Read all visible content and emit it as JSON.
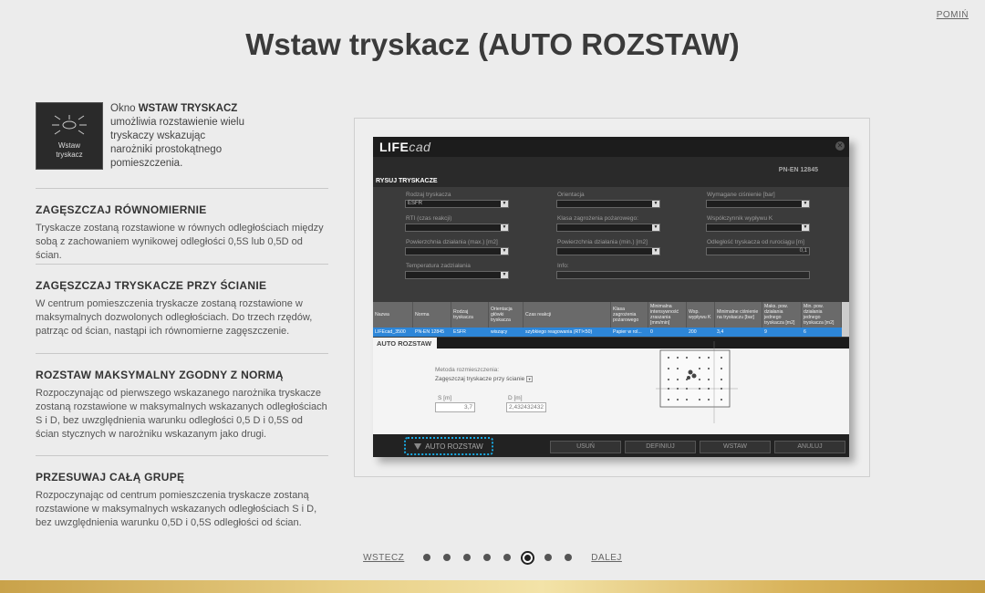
{
  "header": {
    "skip_label": "POMIŃ",
    "title": "Wstaw tryskacz (AUTO ROZSTAW)"
  },
  "intro": {
    "icon_label": "Wstaw\ntryskacz",
    "text_before": "Okno ",
    "text_bold": "WSTAW TRYSKACZ",
    "text_after": " umożliwia rozstawienie wielu tryskaczy wskazując narożniki prostokątnego pomieszczenia."
  },
  "sections": [
    {
      "heading": "ZAGĘSZCZAJ RÓWNOMIERNIE",
      "text": "Tryskacze zostaną rozstawione w równych odległościach między sobą z zachowaniem wynikowej odległości 0,5S lub 0,5D od ścian."
    },
    {
      "heading": "ZAGĘSZCZAJ TRYSKACZE PRZY ŚCIANIE",
      "text": "W centrum pomieszczenia tryskacze zostaną rozstawione w maksymalnych dozwolonych odległościach. Do trzech rzędów, patrząc od ścian, nastąpi ich równomierne zagęszczenie."
    },
    {
      "heading": "ROZSTAW MAKSYMALNY ZGODNY Z NORMĄ",
      "text": "Rozpoczynając od pierwszego wskazanego narożnika tryskacze zostaną rozstawione w maksymalnych wskazanych odległościach S i D, bez uwzględnienia warunku odległości 0,5 D i 0,5S od ścian stycznych w narożniku wskazanym jako drugi."
    },
    {
      "heading": "PRZESUWAJ CAŁĄ GRUPĘ",
      "text": "Rozpoczynając od centrum pomieszczenia tryskacze zostaną rozstawione w maksymalnych wskazanych odległościach S i D, bez uwzględnienia warunku 0,5D i 0,5S odległości od ścian."
    }
  ],
  "app": {
    "logo_main": "LIFE",
    "logo_cad": "cad",
    "close_icon": "close-icon",
    "norm": "PN-EN 12845",
    "section_title": "RYSUJ TRYSKACZE",
    "fields": {
      "rodzaj_label": "Rodzaj tryskacza",
      "rodzaj_value": "ESFR",
      "orientacja_label": "Orientacja",
      "cisnienie_label": "Wymagane ciśnienie [bar]",
      "rti_label": "RTI (czas reakcji)",
      "klasa_label": "Klasa zagrożenia pożarowego:",
      "wspolczynnik_label": "Współczynnik wypływu K",
      "pow_max_label": "Powierzchnia działania (max.) [m2]",
      "pow_min_label": "Powierzchnia działania (min.) [m2]",
      "odleglosc_label": "Odległość tryskacza od rurociągu [m]",
      "odleglosc_value": "0,1",
      "temperatura_label": "Temperatura zadziałania",
      "info_label": "Info:"
    },
    "table": {
      "headers": [
        "Nazwa",
        "Norma",
        "Rodzaj tryskacza",
        "Orientacja główki tryskacza",
        "Czas reakcji",
        "Klasa zagrożenia pożarowego",
        "Minimalna intensywność zraszania [mm/min]",
        "Wsp. wypływu K",
        "Minimalne ciśnienie na tryskaczu [bar]",
        "Maks. pow. działania jednego tryskacza [m2]",
        "Min. pow. działania jednego tryskacza [m2]"
      ],
      "row": [
        "LIFEcad_3500",
        "PN-EN 12845",
        "ESFR",
        "wiszący",
        "szybkiego reagowania (RTI<50)",
        "Papier w rol...",
        "0",
        "200",
        "3,4",
        "9",
        "6"
      ]
    },
    "auto": {
      "tab_label": "AUTO ROZSTAW",
      "method_label": "Metoda rozmieszczenia:",
      "method_value": "Zagęszczaj tryskacze przy ścianie",
      "s_label": "S [m]",
      "s_value": "3,7",
      "d_label": "D [m]",
      "d_value": "2,432432432"
    },
    "footer": {
      "auto_button": "AUTO ROZSTAW",
      "usun": "USUŃ",
      "definiuj": "DEFINIUJ",
      "wstaw": "WSTAW",
      "anuluj": "ANULUJ"
    }
  },
  "pager": {
    "prev": "WSTECZ",
    "next": "DALEJ",
    "pages": 8,
    "active_index": 5
  }
}
